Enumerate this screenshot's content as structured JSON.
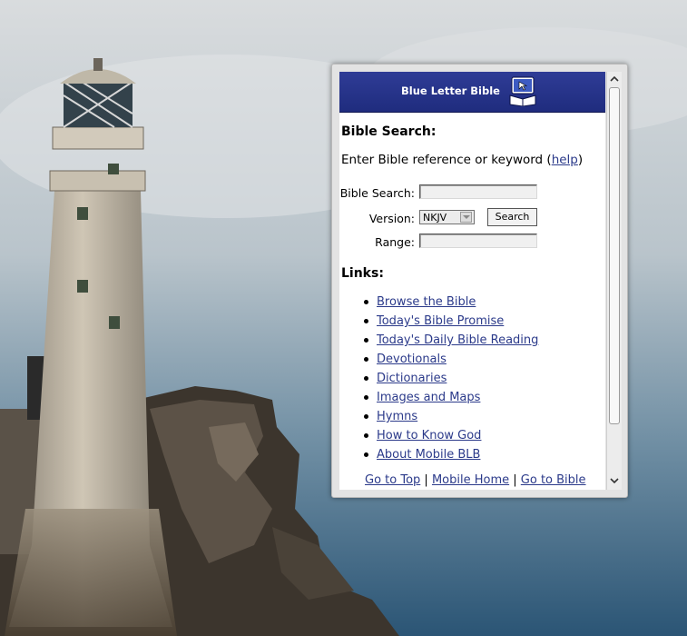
{
  "banner": {
    "title": "Blue Letter Bible"
  },
  "search": {
    "heading": "Bible Search:",
    "intro_text": "Enter Bible reference or keyword (",
    "help_link": "help",
    "intro_close": ")",
    "bible_search_label": "Bible Search:",
    "bible_search_value": "",
    "version_label": "Version:",
    "version_selected": "NKJV",
    "search_button": "Search",
    "range_label": "Range:",
    "range_value": ""
  },
  "links": {
    "heading": "Links:",
    "items": [
      "Browse the Bible",
      "Today's Bible Promise",
      "Today's Daily Bible Reading",
      "Devotionals",
      "Dictionaries",
      "Images and Maps",
      "Hymns",
      "How to Know God",
      "About Mobile BLB"
    ]
  },
  "footer": {
    "go_to_top": "Go to Top",
    "separator": "|",
    "mobile_home": "Mobile Home",
    "go_to_bible": "Go to Bible"
  },
  "colors": {
    "banner": "#27348a",
    "link": "#2b3a8a"
  }
}
